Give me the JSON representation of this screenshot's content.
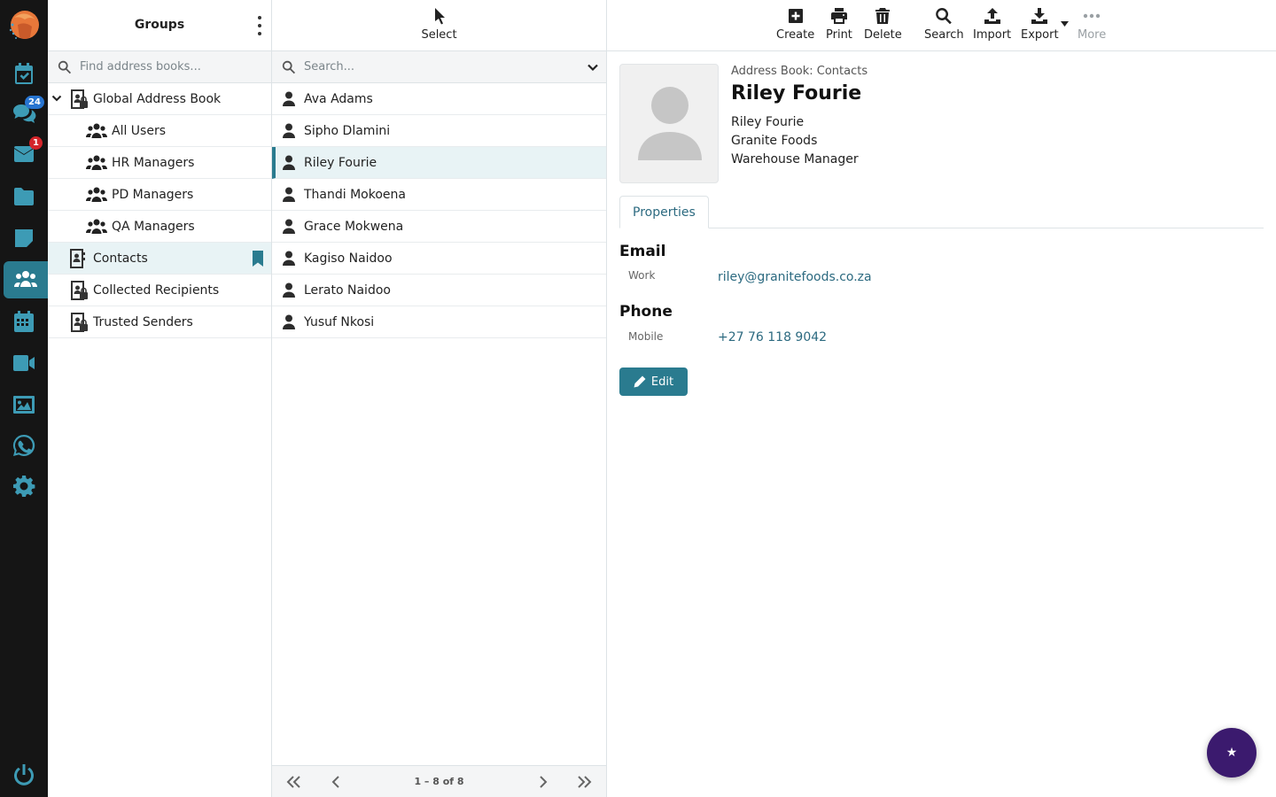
{
  "rail": {
    "items": [
      {
        "icon": "tasks-icon"
      },
      {
        "icon": "chat-icon",
        "badge": "24"
      },
      {
        "icon": "mail-icon",
        "badge": "1"
      },
      {
        "icon": "files-icon"
      },
      {
        "icon": "notes-icon"
      },
      {
        "icon": "contacts-icon",
        "active": true
      },
      {
        "icon": "calendar-icon"
      },
      {
        "icon": "video-icon"
      },
      {
        "icon": "photos-icon"
      },
      {
        "icon": "whatsapp-icon"
      },
      {
        "icon": "settings-icon"
      },
      {
        "icon": "power-icon"
      }
    ]
  },
  "groups": {
    "title": "Groups",
    "search_placeholder": "Find address books...",
    "tree": [
      {
        "label": "Global Address Book",
        "expanded": true
      },
      {
        "label": "All Users"
      },
      {
        "label": "HR Managers"
      },
      {
        "label": "PD Managers"
      },
      {
        "label": "QA Managers"
      },
      {
        "label": "Contacts",
        "selected": true
      },
      {
        "label": "Collected Recipients"
      },
      {
        "label": "Trusted Senders"
      }
    ]
  },
  "list": {
    "select_label": "Select",
    "search_placeholder": "Search...",
    "contacts": [
      "Ava Adams",
      "Sipho Dlamini",
      "Riley Fourie",
      "Thandi Mokoena",
      "Grace Mokwena",
      "Kagiso Naidoo",
      "Lerato Naidoo",
      "Yusuf Nkosi"
    ],
    "selected_index": 2,
    "pager": "1 – 8 of 8"
  },
  "toolbar": {
    "create": "Create",
    "print": "Print",
    "delete": "Delete",
    "search": "Search",
    "import": "Import",
    "export": "Export",
    "more": "More"
  },
  "detail": {
    "address_book": "Address Book: Contacts",
    "name": "Riley Fourie",
    "line1": "Riley Fourie",
    "company": "Granite Foods",
    "job_title": "Warehouse Manager",
    "tab": "Properties",
    "email_heading": "Email",
    "email_label": "Work",
    "email_value": "riley@granitefoods.co.za",
    "phone_heading": "Phone",
    "phone_label": "Mobile",
    "phone_value": "+27 76 118 9042",
    "edit_label": "Edit"
  },
  "fab": {
    "glyph": "★"
  },
  "colors": {
    "accent": "#2a7b8f",
    "rail_bg": "#151515",
    "link": "#2c6a80",
    "fab": "#3b1a6e"
  }
}
